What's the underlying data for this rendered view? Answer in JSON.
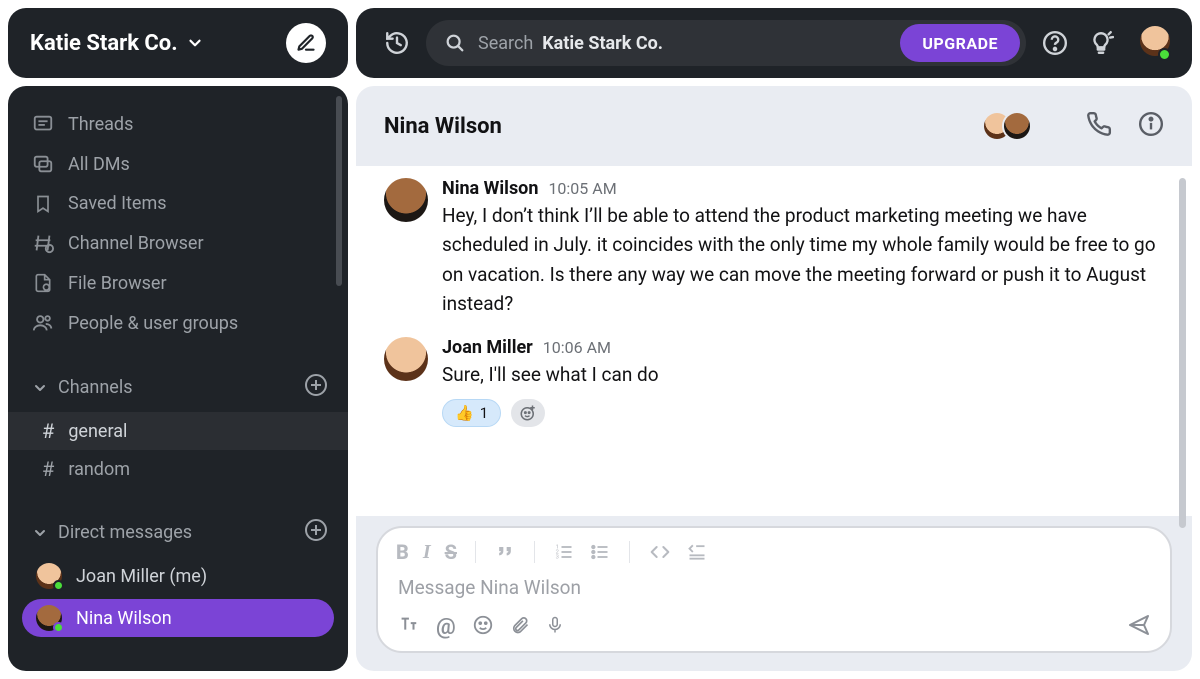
{
  "workspace": {
    "name": "Katie Stark Co."
  },
  "search": {
    "prefix": "Search",
    "workspace": "Katie Stark Co."
  },
  "upgrade": {
    "label": "UPGRADE"
  },
  "nav": {
    "threads": "Threads",
    "all_dms": "All DMs",
    "saved": "Saved Items",
    "channel_browser": "Channel Browser",
    "file_browser": "File Browser",
    "people": "People & user groups"
  },
  "sections": {
    "channels": "Channels",
    "dms": "Direct messages"
  },
  "channels": [
    {
      "name": "general",
      "active": true
    },
    {
      "name": "random",
      "active": false
    }
  ],
  "dms": [
    {
      "name": "Joan Miller (me)",
      "selected": false,
      "face": "face-joan"
    },
    {
      "name": "Nina Wilson",
      "selected": true,
      "face": "face-nina"
    }
  ],
  "conversation": {
    "title": "Nina Wilson"
  },
  "messages": [
    {
      "sender": "Nina Wilson",
      "time": "10:05 AM",
      "face": "face-nina",
      "text": "Hey, I don’t think I’ll be able to attend the product marketing meeting we have scheduled in July. it coincides with the only time my whole family would be free to go on vacation. Is there any way we can move the meeting forward or push it to August instead?",
      "reactions": []
    },
    {
      "sender": "Joan Miller",
      "time": "10:06 AM",
      "face": "face-joan",
      "text": "Sure, I'll see what I can do",
      "reactions": [
        {
          "emoji": "👍",
          "count": "1"
        }
      ]
    }
  ],
  "composer": {
    "placeholder": "Message Nina Wilson"
  }
}
